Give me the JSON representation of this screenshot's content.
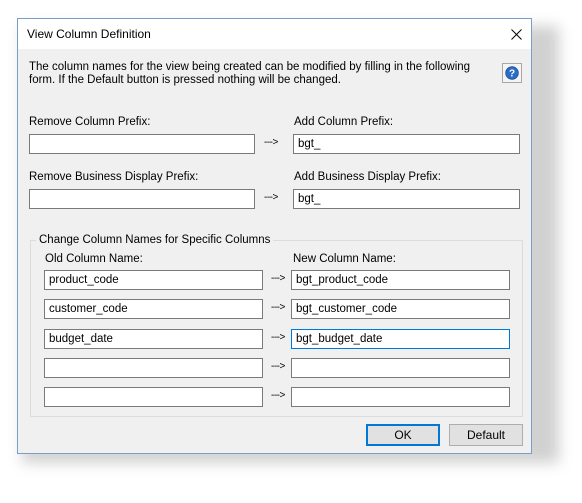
{
  "window": {
    "title": "View Column Definition"
  },
  "description": "The column names for the view being created can be modified by filling in the following form. If the Default button is pressed nothing will be changed.",
  "prefix": {
    "remove_column_label": "Remove Column Prefix:",
    "remove_column_value": "",
    "add_column_label": "Add Column Prefix:",
    "add_column_value": "bgt_",
    "remove_business_label": "Remove Business Display Prefix:",
    "remove_business_value": "",
    "add_business_label": "Add Business Display Prefix:",
    "add_business_value": "bgt_",
    "arrow": "--->"
  },
  "specific": {
    "group_title": "Change Column Names for Specific Columns",
    "old_label": "Old Column Name:",
    "new_label": "New Column Name:",
    "rows": [
      {
        "old": "product_code",
        "new": "bgt_product_code"
      },
      {
        "old": "customer_code",
        "new": "bgt_customer_code"
      },
      {
        "old": "budget_date",
        "new": "bgt_budget_date"
      },
      {
        "old": "",
        "new": ""
      },
      {
        "old": "",
        "new": ""
      }
    ],
    "arrow": "--->"
  },
  "buttons": {
    "ok": "OK",
    "default": "Default"
  },
  "icons": {
    "close": "close-icon",
    "help": "help-icon"
  },
  "colors": {
    "accent": "#0078d7",
    "help_blue": "#2b6cc4"
  }
}
